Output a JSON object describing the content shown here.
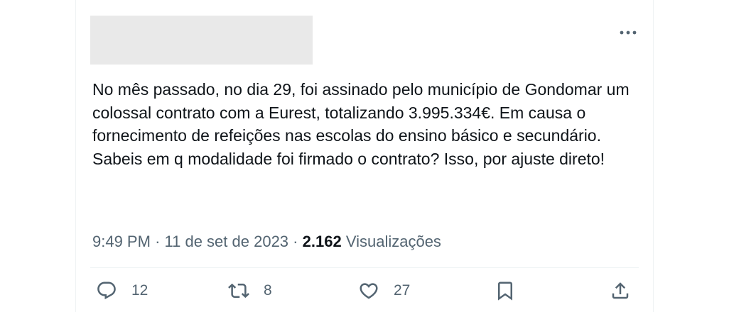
{
  "tweet": {
    "paragraphs": [
      "No mês passado, no dia 29, foi assinado pelo município de Gondomar um colossal contrato com a Eurest, totalizando 3.995.334€. Em causa o fornecimento de refeições nas escolas do ensino básico e secundário.",
      "Sabeis em q modalidade foi firmado o contrato? Isso, por ajuste direto!"
    ],
    "time": "9:49 PM",
    "separator": "·",
    "date": "11 de set de 2023",
    "views_count": "2.162",
    "views_label": "Visualizações"
  },
  "actions": {
    "reply_count": "12",
    "retweet_count": "8",
    "like_count": "27"
  },
  "icons": {
    "more": "more-horizontal-icon",
    "reply": "reply-bubble-icon",
    "retweet": "retweet-icon",
    "like": "heart-icon",
    "bookmark": "bookmark-icon",
    "share": "share-upload-icon"
  },
  "colors": {
    "text": "#0f1419",
    "secondary": "#536471",
    "border": "#eff3f4",
    "redacted": "#e9e9e9"
  }
}
